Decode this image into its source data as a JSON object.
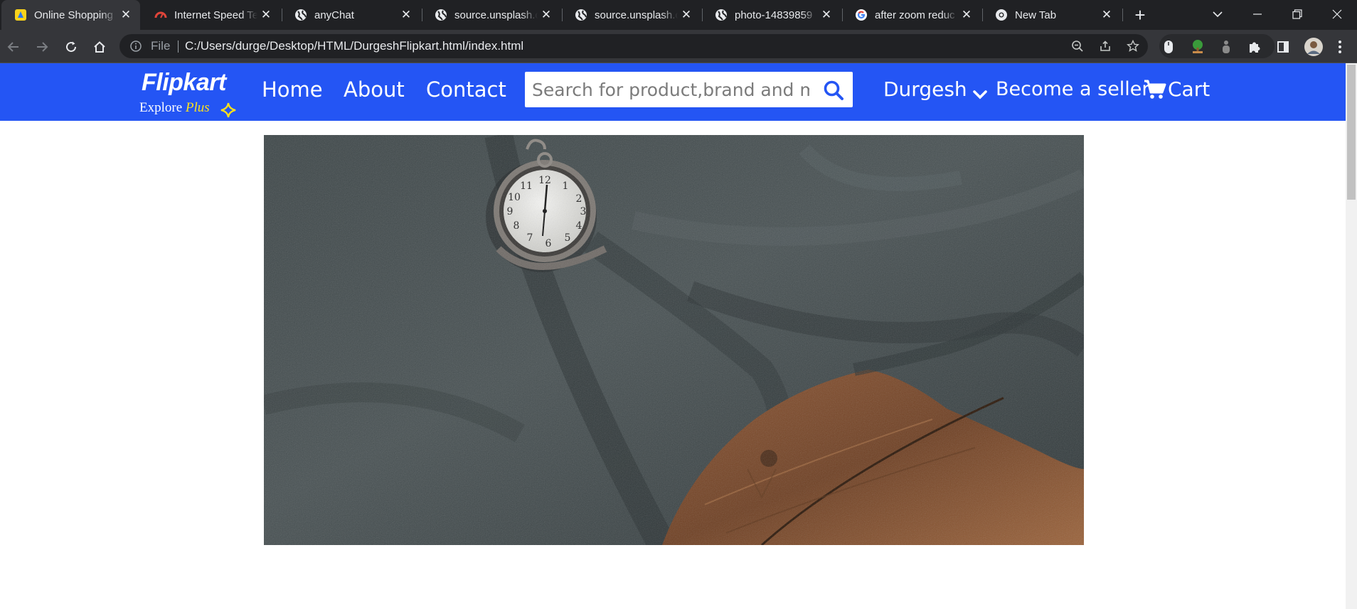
{
  "browser": {
    "tabs": [
      {
        "title": "Online Shopping",
        "favicon": "flipkart-favicon",
        "active": true
      },
      {
        "title": "Internet Speed Te",
        "favicon": "speedometer-favicon",
        "active": false
      },
      {
        "title": "anyChat",
        "favicon": "globe-favicon",
        "active": false
      },
      {
        "title": "source.unsplash.c",
        "favicon": "globe-favicon",
        "active": false
      },
      {
        "title": "source.unsplash.c",
        "favicon": "globe-favicon",
        "active": false
      },
      {
        "title": "photo-14839859",
        "favicon": "globe-favicon",
        "active": false
      },
      {
        "title": "after zoom reduc",
        "favicon": "google-favicon",
        "active": false
      },
      {
        "title": "New Tab",
        "favicon": "chrome-favicon",
        "active": false
      }
    ],
    "tab_close_glyph": "✕",
    "new_tab_glyph": "+",
    "address": {
      "scheme_label": "File",
      "url": "C:/Users/durge/Desktop/HTML/DurgeshFlipkart.html/index.html"
    }
  },
  "site": {
    "logo": {
      "name": "Flipkart",
      "tagline_prefix": "Explore ",
      "tagline_plus": "Plus"
    },
    "nav": {
      "home": "Home",
      "about": "About",
      "contact": "Contact"
    },
    "search": {
      "placeholder": "Search for product,brand and more",
      "value": ""
    },
    "user_label": "Durgesh",
    "seller_label": "Become a seller",
    "cart_label": "Cart",
    "hero_image": "pocket-watch-on-grey-fabric-and-wood"
  },
  "colors": {
    "navbar": "#2455f4",
    "logo_plus": "#ffe11b",
    "tab_strip": "#202124",
    "toolbar": "#35363a"
  }
}
